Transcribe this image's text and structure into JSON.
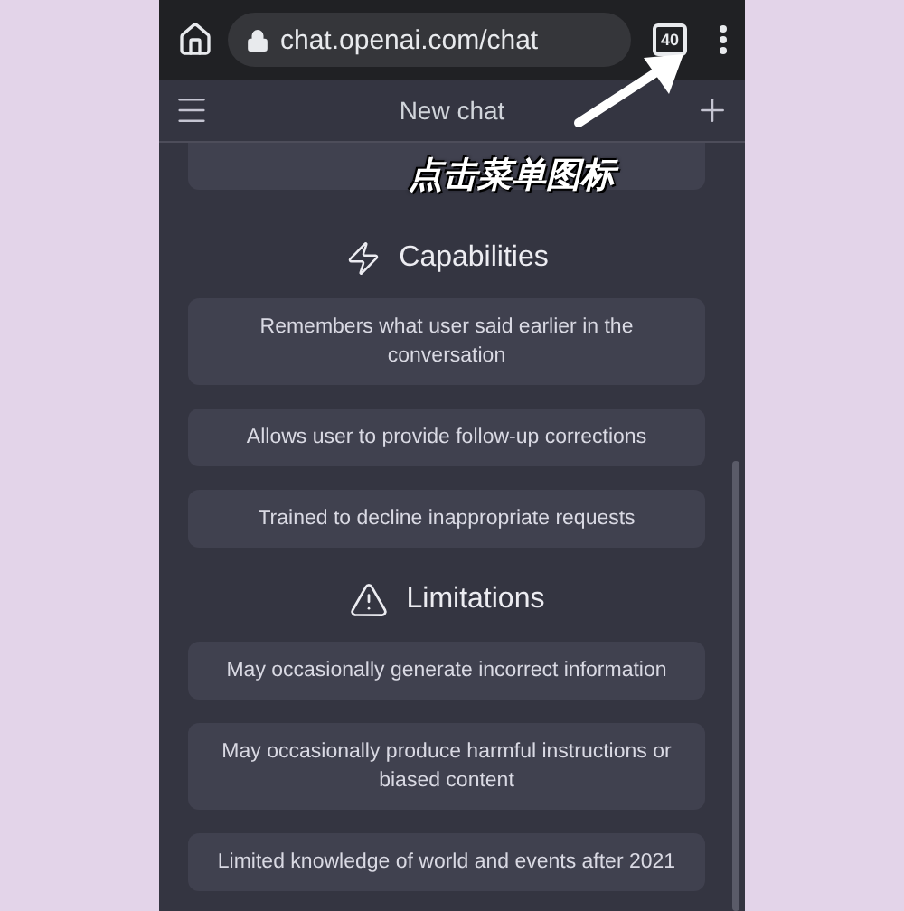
{
  "browser": {
    "url": "chat.openai.com/chat",
    "tab_count": "40"
  },
  "header": {
    "title": "New chat"
  },
  "annotation": {
    "caption": "点击菜单图标"
  },
  "sections": [
    {
      "kind": "capabilities",
      "title": "Capabilities",
      "items": [
        "Remembers what user said earlier in the conversation",
        "Allows user to provide follow-up corrections",
        "Trained to decline inappropriate requests"
      ]
    },
    {
      "kind": "limitations",
      "title": "Limitations",
      "items": [
        "May occasionally generate incorrect information",
        "May occasionally produce harmful instructions or biased content",
        "Limited knowledge of world and events after 2021"
      ]
    }
  ]
}
